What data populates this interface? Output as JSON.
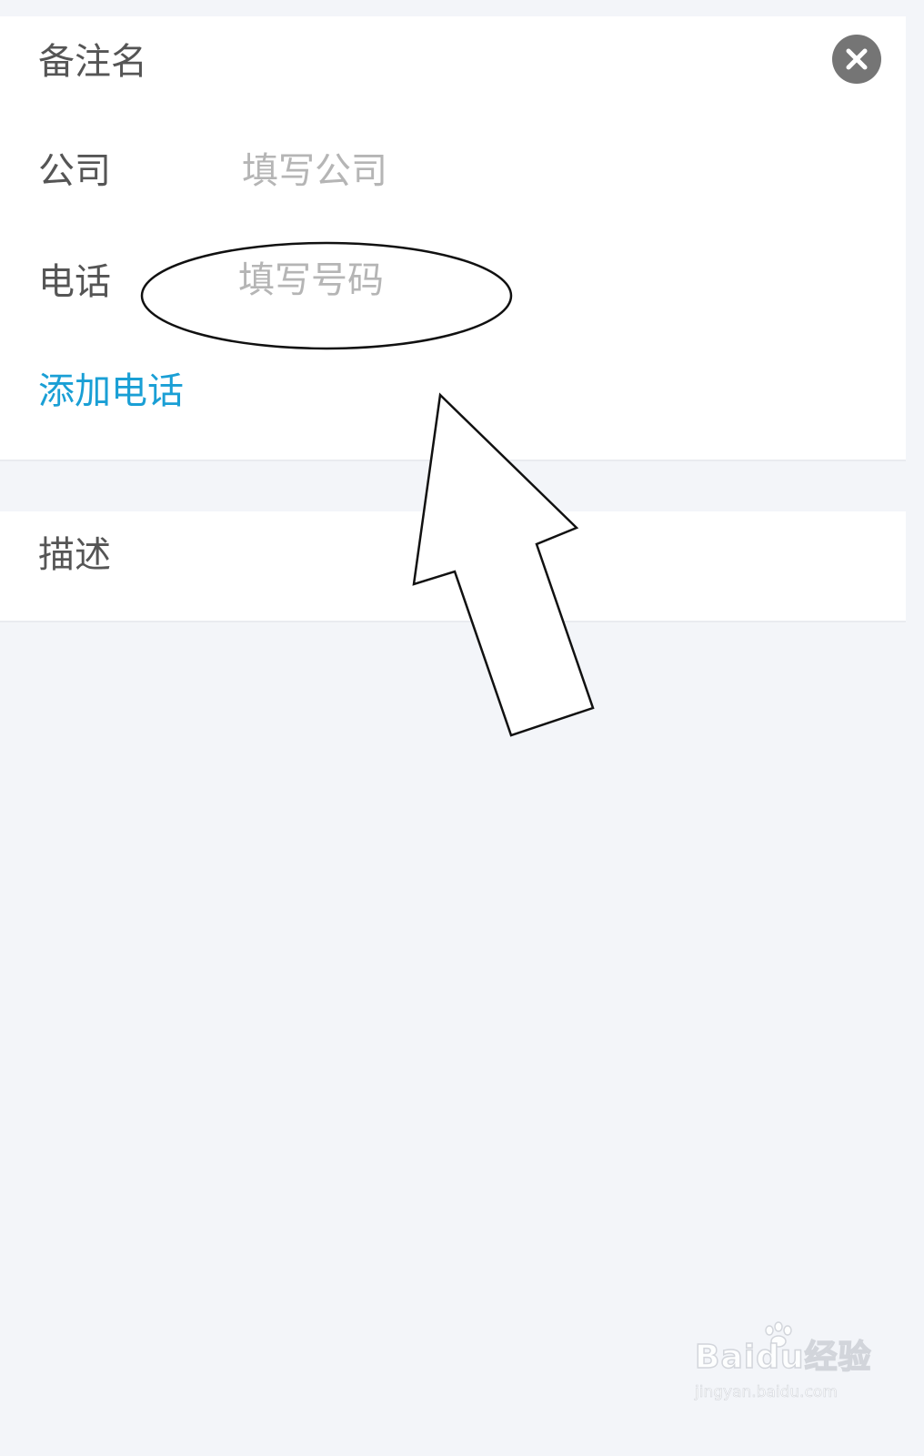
{
  "form": {
    "nickname_label": "备注名",
    "company_label": "公司",
    "company_placeholder": "填写公司",
    "phone_label": "电话",
    "phone_placeholder": "填写号码",
    "add_phone_label": "添加电话",
    "description_label": "描述"
  },
  "icons": {
    "clear": "close-circle-icon"
  },
  "watermark": {
    "brand": "Baidu经验",
    "url": "jingyan.baidu.com"
  },
  "colors": {
    "background": "#f3f5f9",
    "card": "#ffffff",
    "label_text": "#555555",
    "placeholder_text": "#b5b5b5",
    "link_accent": "#1a9fd5",
    "clear_icon": "#757575"
  }
}
